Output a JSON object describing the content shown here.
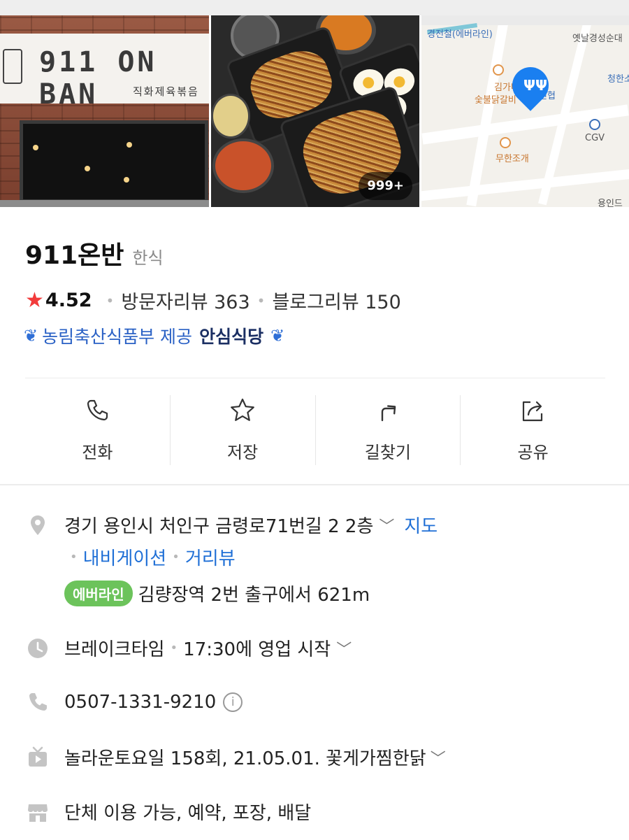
{
  "photos": {
    "storefront_sign": "911 ON BAN",
    "storefront_sub": "직화제육볶음",
    "photo_count": "999+",
    "map_labels": [
      "경전철(에버라인)",
      "옛날경성순대",
      "청한소",
      "김가네",
      "숯불닭갈비",
      "신협",
      "CGV",
      "무한조개",
      "용인드"
    ]
  },
  "place": {
    "name": "911온반",
    "category": "한식",
    "rating": "4.52",
    "visitor_reviews": "방문자리뷰 363",
    "blog_reviews": "블로그리뷰 150",
    "cert_text": "농림축산식품부 제공",
    "cert_badge": "안심식당"
  },
  "actions": [
    {
      "label": "전화",
      "icon": "phone-icon"
    },
    {
      "label": "저장",
      "icon": "star-icon"
    },
    {
      "label": "길찾기",
      "icon": "directions-icon"
    },
    {
      "label": "공유",
      "icon": "share-icon"
    }
  ],
  "info": {
    "address": "경기 용인시 처인구 금령로71번길 2 2층",
    "map_link": "지도",
    "nav_link": "내비게이션",
    "street_link": "거리뷰",
    "subway_line": "에버라인",
    "subway_text": "김량장역 2번 출구에서 621m",
    "hours_status": "브레이크타임",
    "hours_next": "17:30에 영업 시작",
    "phone": "0507-1331-9210",
    "tv": "놀라운토요일 158회, 21.05.01. 꽃게가찜한닭",
    "services": "단체 이용 가능, 예약, 포장, 배달"
  },
  "colors": {
    "accent_blue": "#1f6fd6",
    "star_red": "#f23b3b",
    "subway_green": "#6cc35b",
    "map_pin": "#1a7ff0"
  }
}
